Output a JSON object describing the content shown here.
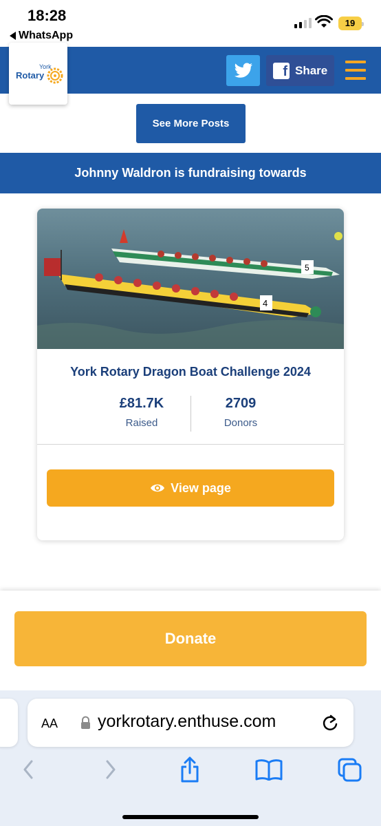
{
  "status_bar": {
    "time": "18:28",
    "back_app": "WhatsApp",
    "battery": "19"
  },
  "header": {
    "logo_city": "York",
    "logo_name": "Rotary",
    "twitter_icon": "twitter-bird-icon",
    "share_label": "Share",
    "menu_icon": "hamburger-menu-icon"
  },
  "posts": {
    "see_more_label": "See More Posts"
  },
  "fundraising": {
    "banner_text": "Johnny Waldron is fundraising towards"
  },
  "campaign": {
    "title": "York Rotary Dragon Boat Challenge 2024",
    "raised_value": "£81.7K",
    "raised_label": "Raised",
    "donors_value": "2709",
    "donors_label": "Donors",
    "view_label": "View page"
  },
  "donate": {
    "label": "Donate"
  },
  "browser": {
    "aa_label": "AA",
    "url": "yorkrotary.enthuse.com"
  },
  "colors": {
    "brand_blue": "#1f5aa6",
    "accent_orange": "#f5a81f",
    "donate_orange": "#f7b538",
    "twitter_blue": "#3ca3ea",
    "facebook_blue": "#2f4f96"
  }
}
